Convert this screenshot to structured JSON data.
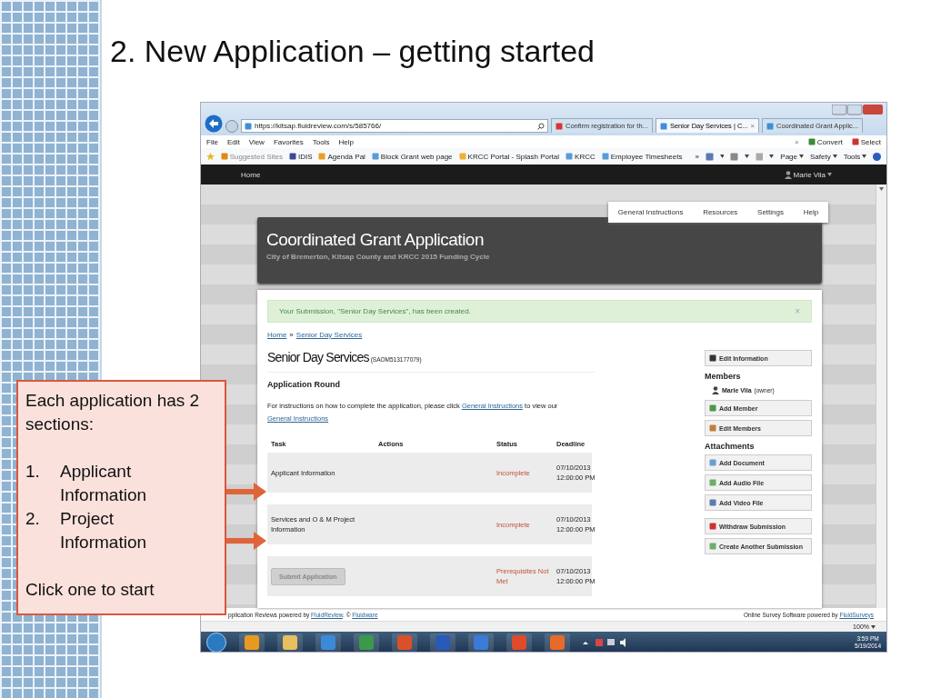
{
  "slide": {
    "title": "2. New Application – getting started"
  },
  "browser": {
    "address": "https://kitsap.fluidreview.com/s/585766/",
    "tabs": [
      {
        "label": "Confirm registration for th...",
        "selected": false
      },
      {
        "label": "Senior Day Services | C...",
        "selected": true
      },
      {
        "label": "Coordinated Grant Applic...",
        "selected": false
      }
    ],
    "tab_close": "×",
    "menu": [
      "File",
      "Edit",
      "View",
      "Favorites",
      "Tools",
      "Help"
    ],
    "menu_close": "×",
    "menu_right": [
      "Convert",
      "Select"
    ],
    "favorites": [
      "Suggested Sites",
      "IDIS",
      "Agenda Pal",
      "Block Grant web page",
      "KRCC Portal - Splash Portal",
      "KRCC",
      "Employee Timesheets"
    ],
    "overflow": "»",
    "command_bar": [
      "Page",
      "Safety",
      "Tools"
    ],
    "zoom": "100%"
  },
  "site": {
    "nav_home": "Home",
    "user": "Marie Vila",
    "top_links": [
      "General Instructions",
      "Resources",
      "Settings",
      "Help"
    ],
    "header_title": "Coordinated Grant Application",
    "header_subtitle": "City of Bremerton, Kitsap County and KRCC 2015 Funding Cycle",
    "alert": {
      "text": "Your Submission, \"Senior Day Services\", has been created.",
      "close": "×"
    },
    "breadcrumb": [
      "Home",
      "Senior Day Services"
    ],
    "breadcrumb_separator": "»",
    "submission_title": "Senior Day Services",
    "submission_id": "(SAOM513177079)",
    "section": "Application Round",
    "instructions": [
      {
        "text": "For instructions on how to complete the application, please click ",
        "link": false
      },
      {
        "text": "General Instructions",
        "link": true
      },
      {
        "text": " to view our ",
        "link": false
      },
      {
        "text": "General Instructions",
        "link": true
      }
    ],
    "table": {
      "columns": [
        "Task",
        "Actions",
        "Status",
        "Deadline"
      ],
      "rows": [
        {
          "kind": "task",
          "task": "Applicant Information",
          "status": "Incomplete",
          "deadline": "07/10/2013 12:00:00 PM"
        },
        {
          "kind": "task",
          "task": "Services and O & M Project Information",
          "status": "Incomplete",
          "deadline": "07/10/2013 12:00:00 PM"
        },
        {
          "kind": "button",
          "task": "Submit Application",
          "disabled": true,
          "status": "Prerequisites Not Met",
          "deadline": "07/10/2013 12:00:00 PM"
        }
      ]
    },
    "sidebar": [
      {
        "kind": "button",
        "label": "Edit Information"
      },
      {
        "kind": "heading",
        "label": "Members"
      },
      {
        "kind": "member",
        "label": "Marie Vila",
        "note": "(owner)"
      },
      {
        "kind": "button",
        "label": "Add Member"
      },
      {
        "kind": "button",
        "label": "Edit Members"
      },
      {
        "kind": "heading",
        "label": "Attachments"
      },
      {
        "kind": "button",
        "label": "Add Document"
      },
      {
        "kind": "button",
        "label": "Add Audio File"
      },
      {
        "kind": "button",
        "label": "Add Video File"
      },
      {
        "kind": "button",
        "label": "Withdraw Submission"
      },
      {
        "kind": "button",
        "label": "Create Another Submission"
      }
    ],
    "footer_left": [
      {
        "text": "pplication Reviews powered by ",
        "link": false
      },
      {
        "text": "FluidReview",
        "link": true
      },
      {
        "text": ". © ",
        "link": false
      },
      {
        "text": "Fluidware",
        "link": true
      }
    ],
    "footer_right": [
      {
        "text": "Online Survey Software powered by ",
        "link": false
      },
      {
        "text": "FluidSurveys",
        "link": true
      }
    ]
  },
  "taskbar": {
    "time": "3:59 PM",
    "date": "5/19/2014"
  },
  "callout": {
    "intro": "Each application has 2 sections:",
    "items": [
      {
        "number": "1.",
        "text": "Applicant Information"
      },
      {
        "number": "2.",
        "text": "Project Information"
      }
    ],
    "closing": "Click one to start"
  }
}
